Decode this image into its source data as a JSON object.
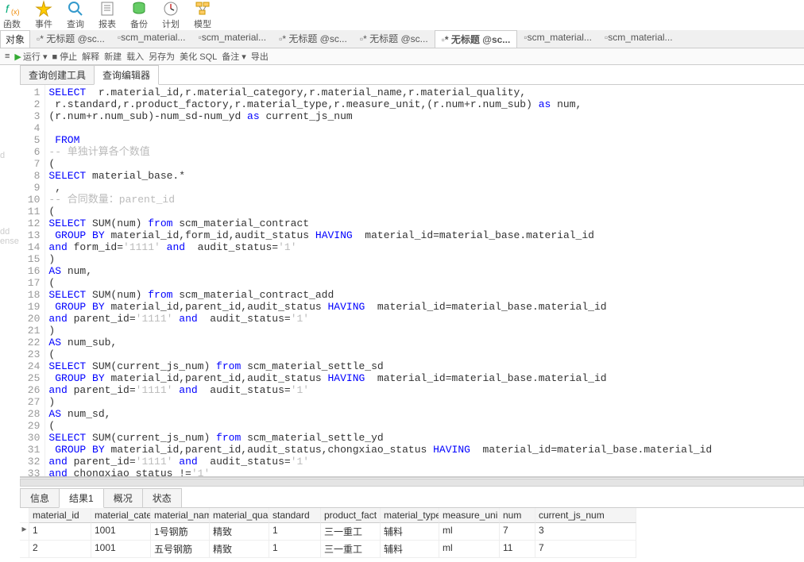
{
  "toolbar": [
    {
      "name": "fn",
      "label": "函数"
    },
    {
      "name": "event",
      "label": "事件"
    },
    {
      "name": "query",
      "label": "查询"
    },
    {
      "name": "report",
      "label": "报表"
    },
    {
      "name": "backup",
      "label": "备份"
    },
    {
      "name": "plan",
      "label": "计划"
    },
    {
      "name": "model",
      "label": "模型"
    }
  ],
  "object_label": "对象",
  "doc_tabs": [
    {
      "name": "t1",
      "label": "* 无标题 @sc...",
      "active": false
    },
    {
      "name": "t2",
      "label": "scm_material...",
      "active": false
    },
    {
      "name": "t3",
      "label": "scm_material...",
      "active": false
    },
    {
      "name": "t4",
      "label": "* 无标题 @sc...",
      "active": false
    },
    {
      "name": "t5",
      "label": "* 无标题 @sc...",
      "active": false
    },
    {
      "name": "t6",
      "label": "* 无标题 @sc...",
      "active": true
    },
    {
      "name": "t7",
      "label": "scm_material...",
      "active": false
    },
    {
      "name": "t8",
      "label": "scm_material...",
      "active": false
    }
  ],
  "actions": {
    "run": "运行 ▾",
    "stop": "停止",
    "explain": "解释",
    "new": "新建",
    "load": "载入",
    "saveas": "另存为",
    "beautify": "美化 SQL",
    "remark": "备注 ▾",
    "export": "导出"
  },
  "subtabs": [
    {
      "name": "qb",
      "label": "查询创建工具",
      "active": false
    },
    {
      "name": "qe",
      "label": "查询编辑器",
      "active": true
    }
  ],
  "code_lines": [
    [
      {
        "t": "SELECT",
        "c": "kw"
      },
      {
        "t": "  r.material_id,r.material_category,r.material_name,r.material_quality,"
      }
    ],
    [
      {
        "t": " r.standard,r.product_factory,r.material_type,r.measure_unit,(r.num+r.num_sub) "
      },
      {
        "t": "as",
        "c": "kw"
      },
      {
        "t": " num,"
      }
    ],
    [
      {
        "t": "(r.num+r.num_sub)-num_sd-num_yd "
      },
      {
        "t": "as",
        "c": "kw"
      },
      {
        "t": " current_js_num"
      }
    ],
    [
      {
        "t": ""
      }
    ],
    [
      {
        "t": " FROM",
        "c": "kw"
      }
    ],
    [
      {
        "t": "-- 单独计算各个数值",
        "c": "cmt"
      }
    ],
    [
      {
        "t": "("
      }
    ],
    [
      {
        "t": "SELECT",
        "c": "kw"
      },
      {
        "t": " material_base.*"
      }
    ],
    [
      {
        "t": " ,"
      }
    ],
    [
      {
        "t": "-- 合同数量：parent_id",
        "c": "cmt"
      }
    ],
    [
      {
        "t": "("
      }
    ],
    [
      {
        "t": "SELECT",
        "c": "kw"
      },
      {
        "t": " SUM(num) "
      },
      {
        "t": "from",
        "c": "kw"
      },
      {
        "t": " scm_material_contract"
      }
    ],
    [
      {
        "t": " "
      },
      {
        "t": "GROUP BY",
        "c": "kw"
      },
      {
        "t": " material_id,form_id,audit_status "
      },
      {
        "t": "HAVING",
        "c": "kw"
      },
      {
        "t": "  material_id=material_base.material_id"
      }
    ],
    [
      {
        "t": "and",
        "c": "kw"
      },
      {
        "t": " form_id="
      },
      {
        "t": "'1111'",
        "c": "cmt"
      },
      {
        "t": " "
      },
      {
        "t": "and",
        "c": "kw"
      },
      {
        "t": "  audit_status="
      },
      {
        "t": "'1'",
        "c": "cmt"
      }
    ],
    [
      {
        "t": ")"
      }
    ],
    [
      {
        "t": "AS",
        "c": "kw"
      },
      {
        "t": " num,"
      }
    ],
    [
      {
        "t": "("
      }
    ],
    [
      {
        "t": "SELECT",
        "c": "kw"
      },
      {
        "t": " SUM(num) "
      },
      {
        "t": "from",
        "c": "kw"
      },
      {
        "t": " scm_material_contract_add"
      }
    ],
    [
      {
        "t": " "
      },
      {
        "t": "GROUP BY",
        "c": "kw"
      },
      {
        "t": " material_id,parent_id,audit_status "
      },
      {
        "t": "HAVING",
        "c": "kw"
      },
      {
        "t": "  material_id=material_base.material_id"
      }
    ],
    [
      {
        "t": "and",
        "c": "kw"
      },
      {
        "t": " parent_id="
      },
      {
        "t": "'1111'",
        "c": "cmt"
      },
      {
        "t": " "
      },
      {
        "t": "and",
        "c": "kw"
      },
      {
        "t": "  audit_status="
      },
      {
        "t": "'1'",
        "c": "cmt"
      }
    ],
    [
      {
        "t": ")"
      }
    ],
    [
      {
        "t": "AS",
        "c": "kw"
      },
      {
        "t": " num_sub,"
      }
    ],
    [
      {
        "t": "("
      }
    ],
    [
      {
        "t": "SELECT",
        "c": "kw"
      },
      {
        "t": " SUM(current_js_num) "
      },
      {
        "t": "from",
        "c": "kw"
      },
      {
        "t": " scm_material_settle_sd"
      }
    ],
    [
      {
        "t": " "
      },
      {
        "t": "GROUP BY",
        "c": "kw"
      },
      {
        "t": " material_id,parent_id,audit_status "
      },
      {
        "t": "HAVING",
        "c": "kw"
      },
      {
        "t": "  material_id=material_base.material_id"
      }
    ],
    [
      {
        "t": "and",
        "c": "kw"
      },
      {
        "t": " parent_id="
      },
      {
        "t": "'1111'",
        "c": "cmt"
      },
      {
        "t": " "
      },
      {
        "t": "and",
        "c": "kw"
      },
      {
        "t": "  audit_status="
      },
      {
        "t": "'1'",
        "c": "cmt"
      }
    ],
    [
      {
        "t": ")"
      }
    ],
    [
      {
        "t": "AS",
        "c": "kw"
      },
      {
        "t": " num_sd,"
      }
    ],
    [
      {
        "t": "("
      }
    ],
    [
      {
        "t": "SELECT",
        "c": "kw"
      },
      {
        "t": " SUM(current_js_num) "
      },
      {
        "t": "from",
        "c": "kw"
      },
      {
        "t": " scm_material_settle_yd"
      }
    ],
    [
      {
        "t": " "
      },
      {
        "t": "GROUP BY",
        "c": "kw"
      },
      {
        "t": " material_id,parent_id,audit_status,chongxiao_status "
      },
      {
        "t": "HAVING",
        "c": "kw"
      },
      {
        "t": "  material_id=material_base.material_id"
      }
    ],
    [
      {
        "t": "and",
        "c": "kw"
      },
      {
        "t": " parent_id="
      },
      {
        "t": "'1111'",
        "c": "cmt"
      },
      {
        "t": " "
      },
      {
        "t": "and",
        "c": "kw"
      },
      {
        "t": "  audit_status="
      },
      {
        "t": "'1'",
        "c": "cmt"
      }
    ],
    [
      {
        "t": "and",
        "c": "kw"
      },
      {
        "t": " chongxiao_status !="
      },
      {
        "t": "'1'",
        "c": "cmt"
      }
    ]
  ],
  "result_tabs": [
    {
      "name": "info",
      "label": "信息",
      "active": false
    },
    {
      "name": "res1",
      "label": "结果1",
      "active": true
    },
    {
      "name": "overview",
      "label": "概况",
      "active": false
    },
    {
      "name": "status",
      "label": "状态",
      "active": false
    }
  ],
  "grid_headers": [
    "material_id",
    "material_cate",
    "material_nam",
    "material_qua",
    "standard",
    "product_fact",
    "material_type",
    "measure_uni",
    "num",
    "current_js_num"
  ],
  "grid_rows": [
    [
      "1",
      "1001",
      "1号钢筋",
      "精致",
      "1",
      "三一重工",
      "辅料",
      "ml",
      "7",
      "3"
    ],
    [
      "2",
      "1001",
      "五号钢筋",
      "精致",
      "1",
      "三一重工",
      "辅料",
      "ml",
      "11",
      "7"
    ]
  ],
  "leftpeek": [
    "d",
    "dd",
    "ense"
  ]
}
